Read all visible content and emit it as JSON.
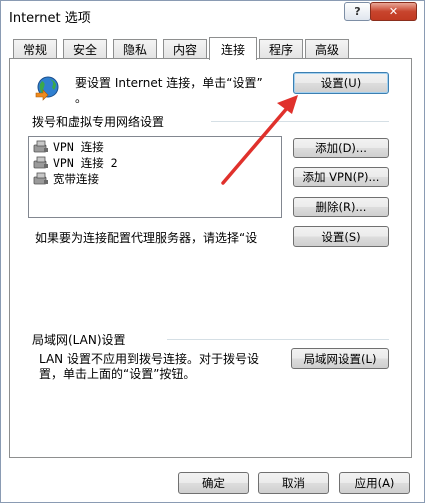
{
  "window": {
    "title": "Internet 选项",
    "help_label": "?",
    "close_label": "✕"
  },
  "tabs": [
    {
      "label": "常规"
    },
    {
      "label": "安全"
    },
    {
      "label": "隐私"
    },
    {
      "label": "内容"
    },
    {
      "label": "连接"
    },
    {
      "label": "程序"
    },
    {
      "label": "高级"
    }
  ],
  "active_tab": "连接",
  "setup": {
    "text_line1": "要设置 Internet 连接，单击“设置”",
    "text_line2": "。",
    "button": "设置(U)"
  },
  "dialup": {
    "heading": "拨号和虚拟专用网络设置",
    "items": [
      {
        "label": "VPN 连接"
      },
      {
        "label": "VPN 连接 2"
      },
      {
        "label": "宽带连接"
      }
    ],
    "add_button": "添加(D)...",
    "add_vpn_button": "添加 VPN(P)...",
    "remove_button": "删除(R)...",
    "proxy_text": "如果要为连接配置代理服务器，请选择“设",
    "settings_button": "设置(S)"
  },
  "lan": {
    "heading": "局域网(LAN)设置",
    "text_line1": "LAN 设置不应用到拨号连接。对于拨号设",
    "text_line2": "置，单击上面的“设置”按钮。",
    "button": "局域网设置(L)"
  },
  "footer": {
    "ok": "确定",
    "cancel": "取消",
    "apply": "应用(A)"
  },
  "annotation": {
    "arrow_color": "#e0312c"
  }
}
